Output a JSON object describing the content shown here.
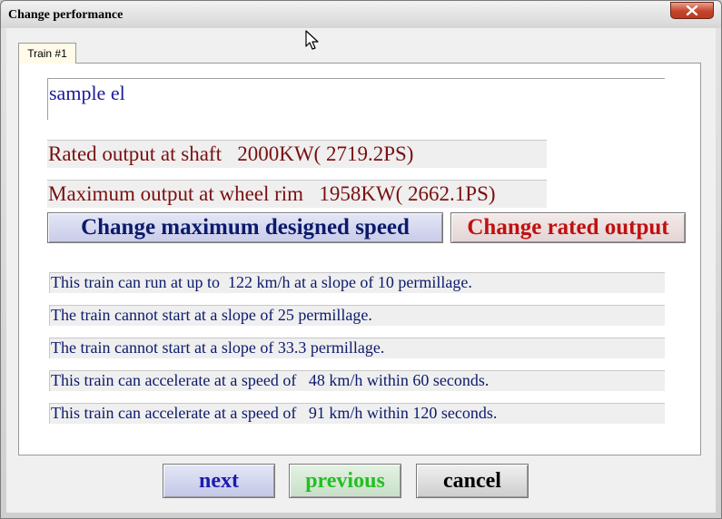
{
  "window": {
    "title": "Change performance",
    "close_icon": "close-icon"
  },
  "tabs": [
    {
      "label": "Train #1",
      "selected": true
    }
  ],
  "train": {
    "name": "sample el",
    "rated_output": "Rated output at shaft   2000KW( 2719.2PS)",
    "max_output": "Maximum output at wheel rim   1958KW( 2662.1PS)"
  },
  "buttons": {
    "change_speed": "Change maximum designed  speed",
    "change_rated": "Change rated output",
    "next": "next",
    "previous": "previous",
    "cancel": "cancel"
  },
  "results": [
    "This train can run at up to  122 km/h at a slope of 10 permillage.",
    "The train cannot start at a slope of 25 permillage.",
    "The train cannot start at a slope of 33.3 permillage.",
    "This train can accelerate at a speed of   48 km/h within 60 seconds.",
    "This train can accelerate at a speed of   91 km/h within 120 seconds."
  ],
  "colors": {
    "name_text": "#1a1a9a",
    "output_text": "#7a1010",
    "speed_button_text": "#0c1a6a",
    "rated_button_text": "#c01010",
    "next_text": "#1b1bb0",
    "previous_text": "#22c022"
  }
}
